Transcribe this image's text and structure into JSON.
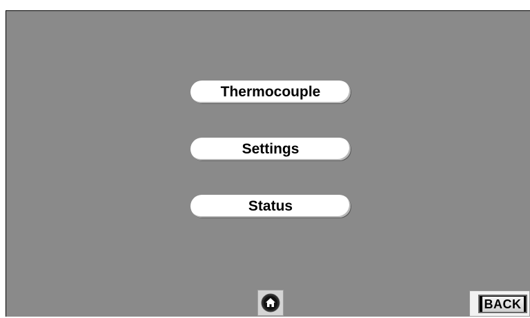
{
  "menu": {
    "items": [
      {
        "label": "Thermocouple"
      },
      {
        "label": "Settings"
      },
      {
        "label": "Status"
      }
    ]
  },
  "footer": {
    "home_icon": "home-icon",
    "back_label": "BACK"
  },
  "colors": {
    "background": "#8a8a8a",
    "button": "#ffffff",
    "text": "#000000"
  }
}
